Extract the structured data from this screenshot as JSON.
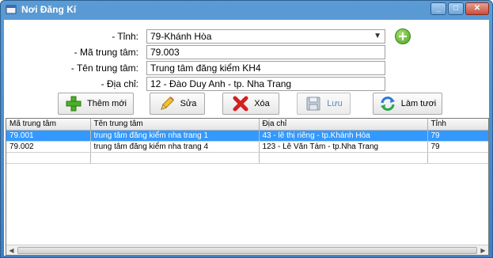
{
  "window": {
    "title": "Nơi Đăng Kí"
  },
  "form": {
    "tinh_label": "- Tỉnh:",
    "tinh_value": "79-Khánh Hòa",
    "ma_label": "- Mã trung tâm:",
    "ma_value": "79.003",
    "ten_label": "- Tên trung tâm:",
    "ten_value": "Trung tâm đăng kiểm KH4",
    "diachi_label": "- Địa chỉ:",
    "diachi_value": "12 - Đào Duy Anh - tp. Nha Trang"
  },
  "toolbar": {
    "add_label": "Thêm mới",
    "edit_label": "Sửa",
    "delete_label": "Xóa",
    "save_label": "Lưu",
    "refresh_label": "Làm tươi"
  },
  "grid": {
    "columns": [
      "Mã trung tâm",
      "Tên trung tâm",
      "Địa chỉ",
      "Tỉnh"
    ],
    "rows": [
      [
        "79.001",
        "trung tâm đăng kiểm nha trang 1",
        "43 - lê thị riêng - tp.Khánh Hòa",
        "79"
      ],
      [
        "79.002",
        "trung tâm đăng kiểm nha trang 4",
        "123 - Lê Văn Tám - tp.Nha Trang",
        "79"
      ]
    ]
  },
  "colors": {
    "selection": "#3399ff",
    "titlebar": "#4a8fd0"
  },
  "icons": [
    "app-icon",
    "minimize-icon",
    "maximize-icon",
    "close-icon",
    "chevron-down-icon",
    "plus-icon",
    "pencil-icon",
    "x-icon",
    "floppy-disk-icon",
    "refresh-icon"
  ]
}
